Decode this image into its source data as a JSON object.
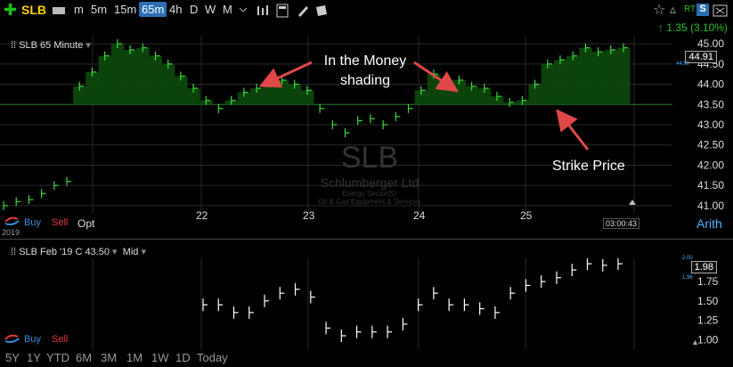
{
  "toolbar": {
    "symbol": "SLB",
    "intervals": [
      "m",
      "5m",
      "15m",
      "65m",
      "4h",
      "D",
      "W",
      "M"
    ],
    "selected_interval": "65m",
    "rt_label": "RT",
    "s_label": "S",
    "change": "1.35 (3.10%)"
  },
  "upper_chart": {
    "title": "SLB 65 Minute",
    "watermark_symbol": "SLB",
    "watermark_company": "Schlumberger Ltd",
    "watermark_sector": "Energy Sector(S)",
    "watermark_industry": "Oil & Gas Equipment & Services",
    "price_box": "44.91",
    "small_price": "44.90",
    "annotation_itm": "In the Money\nshading",
    "annotation_itm_line1": "In the Money",
    "annotation_itm_line2": "shading",
    "annotation_strike": "Strike Price",
    "buy": "Buy",
    "sell": "Sell",
    "opt": "Opt",
    "year_label": "2019",
    "time_label": "03:00:43",
    "scale_label": "Arith"
  },
  "lower_chart": {
    "title": "SLB Feb '19 C 43.50",
    "mode": "Mid",
    "price_box": "1.98",
    "small_top": "2.00",
    "small_bottom": "1.96",
    "buy": "Buy",
    "sell": "Sell"
  },
  "timeframes": [
    "5Y",
    "1Y",
    "YTD",
    "6M",
    "3M",
    "1M",
    "1W",
    "1D",
    "Today"
  ],
  "chart_data": [
    {
      "type": "ohlc",
      "title": "SLB 65 Minute",
      "ylim": [
        40.8,
        45.2
      ],
      "y_ticks": [
        41.0,
        41.5,
        42.0,
        42.5,
        43.0,
        43.5,
        44.0,
        44.5,
        45.0
      ],
      "x_labels": [
        "22",
        "23",
        "24",
        "25"
      ],
      "strike": 43.5,
      "prices": [
        41.0,
        41.1,
        41.15,
        41.3,
        41.5,
        41.6,
        43.95,
        44.3,
        44.7,
        45.0,
        44.85,
        44.9,
        44.7,
        44.5,
        44.2,
        43.9,
        43.6,
        43.4,
        43.6,
        43.8,
        43.9,
        44.05,
        44.1,
        44.0,
        43.85,
        43.4,
        43.0,
        42.8,
        43.1,
        43.15,
        43.0,
        43.2,
        43.4,
        43.85,
        44.25,
        44.05,
        44.1,
        43.95,
        43.9,
        43.7,
        43.55,
        43.6,
        44.0,
        44.5,
        44.6,
        44.7,
        44.9,
        44.8,
        44.85,
        44.9
      ]
    },
    {
      "type": "ohlc",
      "title": "SLB Feb '19 C 43.50",
      "ylim": [
        0.9,
        2.05
      ],
      "y_ticks": [
        1.0,
        1.25,
        1.5,
        1.75
      ],
      "prices": [
        1.45,
        1.45,
        1.35,
        1.35,
        1.5,
        1.6,
        1.65,
        1.55,
        1.15,
        1.05,
        1.1,
        1.1,
        1.1,
        1.2,
        1.45,
        1.6,
        1.45,
        1.45,
        1.4,
        1.35,
        1.6,
        1.7,
        1.75,
        1.8,
        1.9,
        1.98,
        1.96,
        1.98
      ]
    }
  ]
}
